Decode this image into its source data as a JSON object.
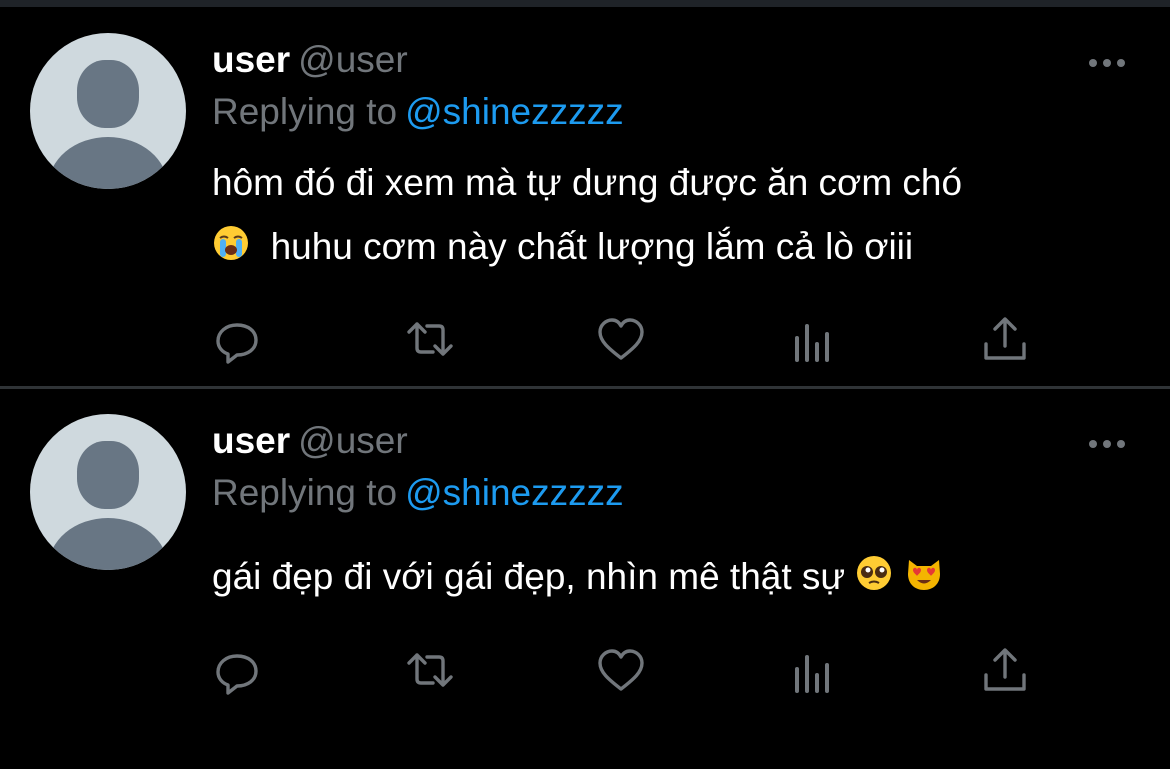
{
  "tweets": [
    {
      "name": "user",
      "handle": "@user",
      "replying_prefix": "Replying to",
      "replying_to": "@shinezzzzz",
      "text_line1": "hôm đó đi xem mà tự dưng được ăn cơm chó",
      "text_line2_emoji": "loudly-crying-face",
      "text_line2": "huhu cơm này chất lượng lắm cả lò ơiii"
    },
    {
      "name": "user",
      "handle": "@user",
      "replying_prefix": "Replying to",
      "replying_to": "@shinezzzzz",
      "text_line1": "gái đẹp đi với gái đẹp, nhìn mê thật sự",
      "text_emojis": [
        "pleading-face",
        "smiling-cat-with-heart-eyes"
      ]
    }
  ],
  "colors": {
    "background": "#000000",
    "secondary_text": "#71767b",
    "mention": "#1d9bf0",
    "divider": "#2f3336",
    "icon": "#71767b"
  },
  "icons": [
    "reply-icon",
    "retweet-icon",
    "like-icon",
    "analytics-icon",
    "share-icon",
    "more-icon"
  ]
}
